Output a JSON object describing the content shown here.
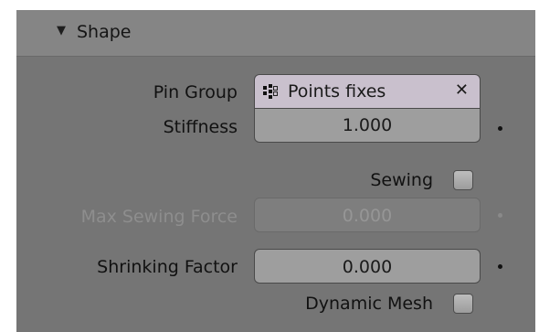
{
  "panel": {
    "title": "Shape",
    "collapse_icon": "triangle-down-icon"
  },
  "pin_group": {
    "label": "Pin Group",
    "value": "Points fixes",
    "icon": "vertex-group-icon",
    "clear_glyph": "✕"
  },
  "stiffness": {
    "label": "Stiffness",
    "value": "1.000"
  },
  "sewing": {
    "label": "Sewing",
    "checked": false
  },
  "max_sewing_force": {
    "label": "Max Sewing Force",
    "value": "0.000",
    "enabled": false
  },
  "shrinking_factor": {
    "label": "Shrinking Factor",
    "value": "0.000"
  },
  "dynamic_mesh": {
    "label": "Dynamic Mesh",
    "checked": false
  },
  "colors": {
    "panel_bg": "#757575",
    "header_bg": "#858585",
    "pin_field_bg": "#c9c0cd",
    "number_field_bg": "#9e9e9e",
    "disabled_text": "#8e8e8e"
  }
}
